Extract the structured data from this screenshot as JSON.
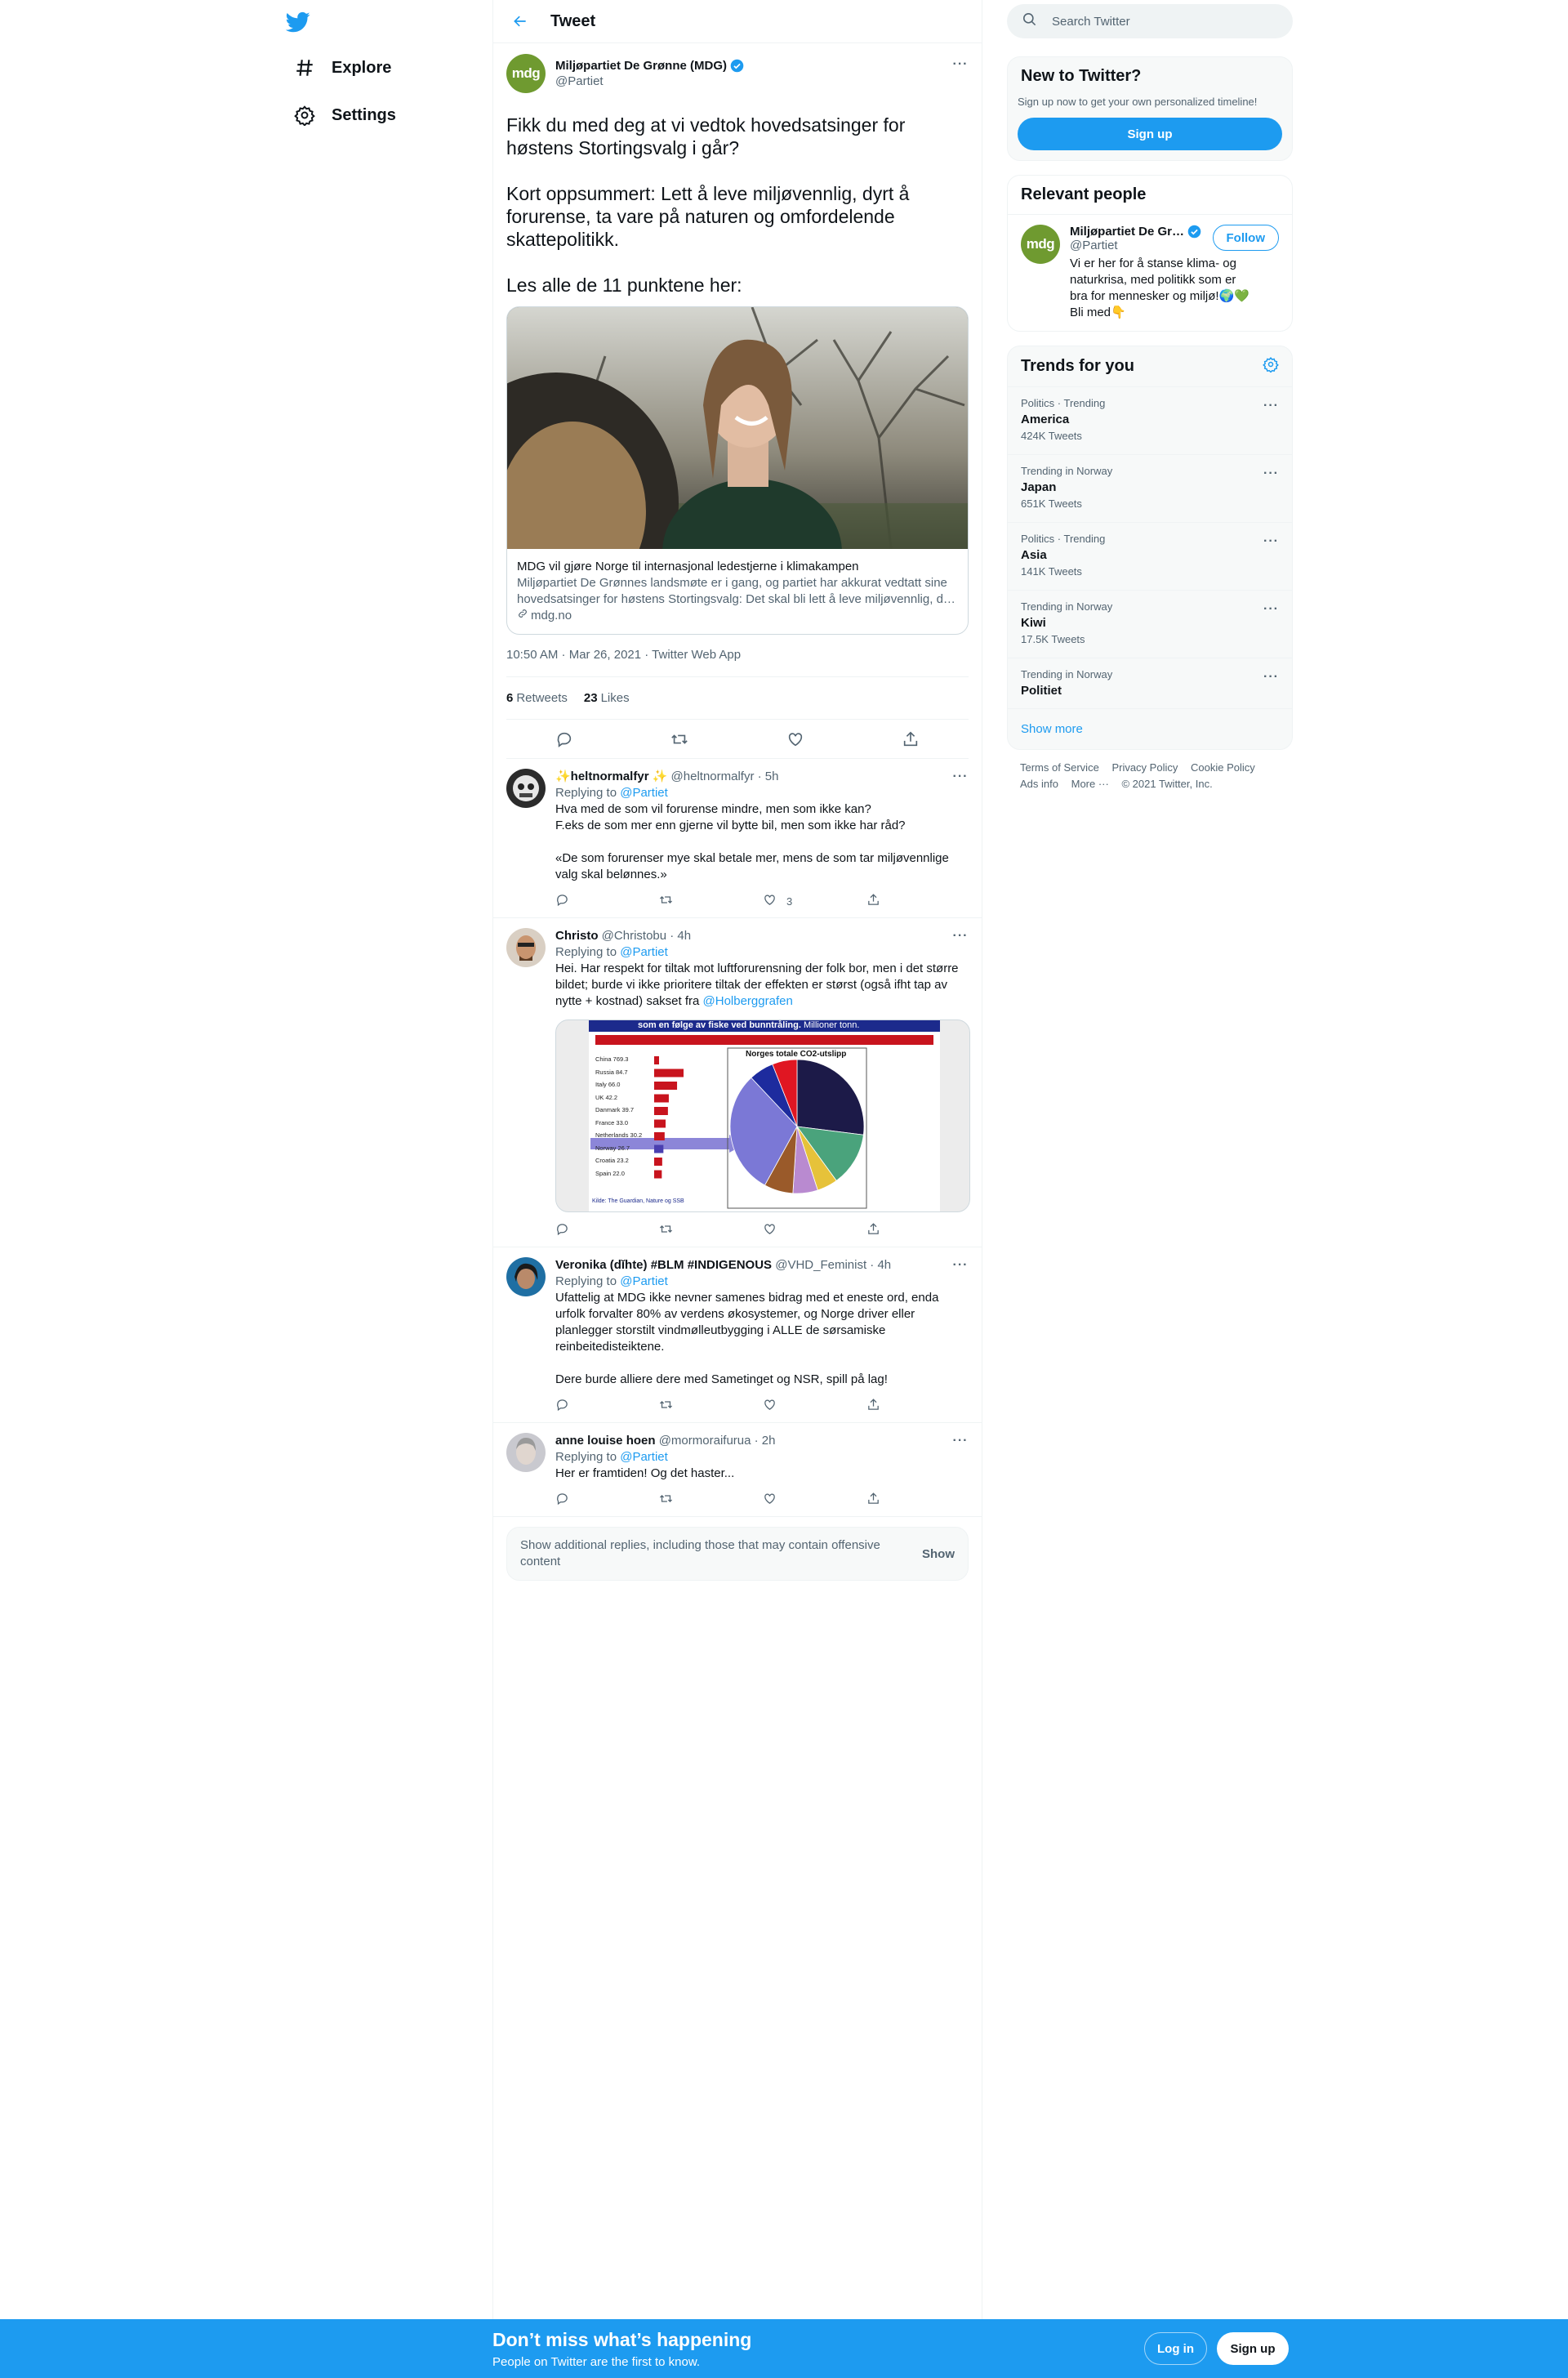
{
  "nav": {
    "logo": "twitter-bird-icon",
    "items": [
      {
        "label": "Explore",
        "icon": "hashtag-icon"
      },
      {
        "label": "Settings",
        "icon": "gear-icon"
      }
    ]
  },
  "header": {
    "title": "Tweet"
  },
  "tweet": {
    "author_name": "Miljøpartiet De Grønne (MDG)",
    "author_handle": "@Partiet",
    "avatar_text": "mdg",
    "text": "Fikk du med deg at vi vedtok hovedsatsinger for høstens Stortingsvalg i går?\n\nKort oppsummert: Lett å leve miljøvennlig, dyrt å forurense, ta vare på naturen og omfordelende skattepolitikk.\n\nLes alle de 11 punktene her:",
    "card": {
      "title": "MDG vil gjøre Norge til internasjonal ledestjerne i klimakampen",
      "description": "Miljøpartiet De Grønnes landsmøte er i gang, og partiet har akkurat vedtatt sine hovedsatsinger for høstens Stortingsvalg: Det skal bli lett å leve miljøvennlig, dyrt å forurense, ta vare på naturen og omfordelende skattepolitikk.",
      "domain": "mdg.no"
    },
    "meta": "10:50 AM · Mar 26, 2021 · Twitter Web App",
    "retweets": "6",
    "retweets_label": "Retweets",
    "likes": "23",
    "likes_label": "Likes"
  },
  "replies": [
    {
      "name": "✨heltnormalfyr ✨",
      "handle": "@heltnormalfyr · 5h",
      "replying_prefix": "Replying to ",
      "replying_to": "@Partiet",
      "text": "Hva med de som vil forurense mindre, men som ikke kan?\nF.eks de som mer enn gjerne vil bytte bil, men som ikke har råd?\n\n«De som forurenser mye skal betale mer, mens de som tar miljøvennlige valg skal belønnes.»",
      "likes": "3"
    },
    {
      "name": "Christo",
      "handle": "@Christobu · 4h",
      "replying_prefix": "Replying to ",
      "replying_to": "@Partiet",
      "text": "Hei. Har respekt for tiltak mot luftforurensning der folk bor, men i det større bildet; burde vi ikke prioritere tiltak der effekten er størst (også ifht tap av nytte + kostnad) sakset fra ",
      "text_mention": "@Holberggrafen",
      "likes": ""
    },
    {
      "name": "Veronika (dǐhte) #BLM #INDIGENOUS",
      "handle": "@VHD_Feminist · 4h",
      "replying_prefix": "Replying to ",
      "replying_to": "@Partiet",
      "text": "Ufattelig at MDG ikke nevner samenes bidrag med et eneste ord, enda urfolk forvalter 80% av verdens økosystemer, og Norge driver eller planlegger storstilt vindmølleutbygging i ALLE de sørsamiske reinbeitedisteiktene.\n\nDere burde alliere dere med Sametinget og NSR, spill på lag!",
      "likes": ""
    },
    {
      "name": "anne louise hoen",
      "handle": "@mormoraifurua · 2h",
      "replying_prefix": "Replying to ",
      "replying_to": "@Partiet",
      "text": "Her er framtiden! Og det haster...",
      "likes": ""
    }
  ],
  "embedded_chart": {
    "banner": "som en følge av fiske ved bunntråling.",
    "banner_unit": "Millioner tonn.",
    "pie_title": "Norges totale CO2-utslipp",
    "source": "Kilde: The Guardian, Nature og SSB",
    "countries": [
      {
        "name": "China",
        "value": "769.3"
      },
      {
        "name": "Russia",
        "value": "84.7"
      },
      {
        "name": "Italy",
        "value": "66.0"
      },
      {
        "name": "UK",
        "value": "42.2"
      },
      {
        "name": "Danmark",
        "value": "39.7"
      },
      {
        "name": "France",
        "value": "33.0"
      },
      {
        "name": "Netherlands",
        "value": "30.2"
      },
      {
        "name": "Norway",
        "value": "26.7"
      },
      {
        "name": "Croatia",
        "value": "23.2"
      },
      {
        "name": "Spain",
        "value": "22.0"
      }
    ]
  },
  "show_more": {
    "text": "Show additional replies, including those that may contain offensive content",
    "button": "Show"
  },
  "search": {
    "placeholder": "Search Twitter"
  },
  "new_to_twitter": {
    "title": "New to Twitter?",
    "subtitle": "Sign up now to get your own personalized timeline!",
    "button": "Sign up"
  },
  "relevant_people": {
    "title": "Relevant people",
    "name": "Miljøpartiet De Gr…",
    "handle": "@Partiet",
    "bio": "Vi er her for å stanse klima- og naturkrisa, med politikk som er bra for mennesker og miljø!🌍💚 Bli med👇",
    "follow": "Follow"
  },
  "trends": {
    "title": "Trends for you",
    "items": [
      {
        "context": "Politics · Trending",
        "name": "America",
        "count": "424K Tweets"
      },
      {
        "context": "Trending in Norway",
        "name": "Japan",
        "count": "651K Tweets"
      },
      {
        "context": "Politics · Trending",
        "name": "Asia",
        "count": "141K Tweets"
      },
      {
        "context": "Trending in Norway",
        "name": "Kiwi",
        "count": "17.5K Tweets"
      },
      {
        "context": "Trending in Norway",
        "name": "Politiet",
        "count": ""
      }
    ],
    "show_more": "Show more"
  },
  "footer": {
    "links": [
      "Terms of Service",
      "Privacy Policy",
      "Cookie Policy",
      "Ads info",
      "More ···",
      "© 2021 Twitter, Inc."
    ]
  },
  "bottom_bar": {
    "title": "Don’t miss what’s happening",
    "subtitle": "People on Twitter are the first to know.",
    "login": "Log in",
    "signup": "Sign up"
  },
  "colors": {
    "accent": "#1d9bf0",
    "mdg_green": "#6f9a30"
  }
}
